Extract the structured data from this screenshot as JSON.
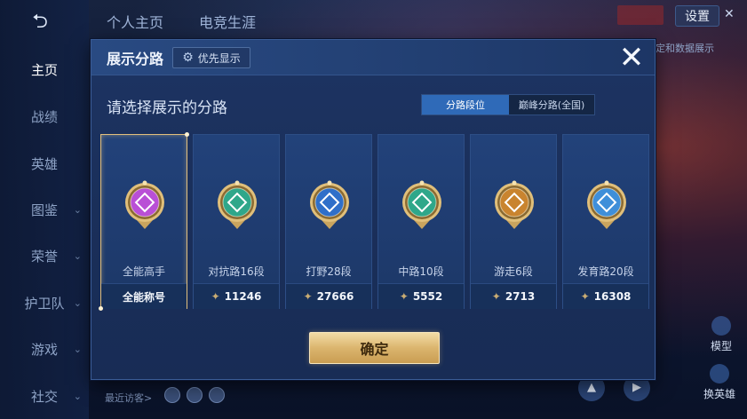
{
  "background": {
    "back_icon": "back-arrow-icon",
    "top_tabs": [
      "个人主页",
      "电竞生涯"
    ],
    "settings_label": "设置",
    "right_text": "定和数据展示",
    "model_label": "模型",
    "swap_hero_label": "换英雄",
    "visitors_label": "最近访客>",
    "nav": [
      {
        "label": "主页",
        "active": true,
        "chevron": false
      },
      {
        "label": "战绩",
        "active": false,
        "chevron": false
      },
      {
        "label": "英雄",
        "active": false,
        "chevron": false
      },
      {
        "label": "图鉴",
        "active": false,
        "chevron": true
      },
      {
        "label": "荣誉",
        "active": false,
        "chevron": true
      },
      {
        "label": "护卫队",
        "active": false,
        "chevron": true
      },
      {
        "label": "游戏",
        "active": false,
        "chevron": true
      },
      {
        "label": "社交",
        "active": false,
        "chevron": true
      }
    ]
  },
  "dialog": {
    "title": "展示分路",
    "priority_label": "优先显示",
    "close_icon": "close-icon",
    "subtitle": "请选择展示的分路",
    "segmented": {
      "active": "分路段位",
      "inactive": "巅峰分路(全国)"
    },
    "cards": [
      {
        "name": "全能高手",
        "footer": "全能称号",
        "selected": true,
        "has_gem": false,
        "color": "#b94fd6",
        "icon": "all-rounder-emblem-icon"
      },
      {
        "name": "对抗路16段",
        "footer": "11246",
        "selected": false,
        "has_gem": true,
        "color": "#2fa78a",
        "icon": "clash-lane-emblem-icon"
      },
      {
        "name": "打野28段",
        "footer": "27666",
        "selected": false,
        "has_gem": true,
        "color": "#2f6fc9",
        "icon": "jungle-emblem-icon"
      },
      {
        "name": "中路10段",
        "footer": "5552",
        "selected": false,
        "has_gem": true,
        "color": "#2fa78a",
        "icon": "mid-lane-emblem-icon"
      },
      {
        "name": "游走6段",
        "footer": "2713",
        "selected": false,
        "has_gem": true,
        "color": "#c9842f",
        "icon": "roam-emblem-icon"
      },
      {
        "name": "发育路20段",
        "footer": "16308",
        "selected": false,
        "has_gem": true,
        "color": "#3f8fd9",
        "icon": "farm-lane-emblem-icon"
      }
    ],
    "confirm_label": "确定"
  }
}
